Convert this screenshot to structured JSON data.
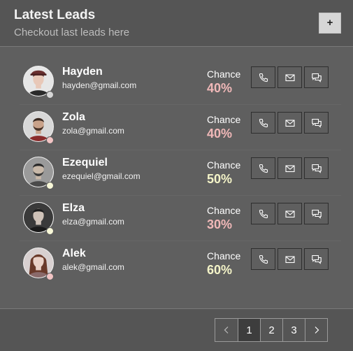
{
  "header": {
    "title": "Latest Leads",
    "subtitle": "Checkout last leads here",
    "add_label": "+"
  },
  "chance_label": "Chance",
  "leads": [
    {
      "name": "Hayden",
      "email": "hayden@gmail.com",
      "chance": "40%",
      "chance_color": "#f0b8b8",
      "status_color": "#d6d6d6"
    },
    {
      "name": "Zola",
      "email": "zola@gmail.com",
      "chance": "40%",
      "chance_color": "#f0b8b8",
      "status_color": "#f2c4c4"
    },
    {
      "name": "Ezequiel",
      "email": "ezequiel@gmail.com",
      "chance": "50%",
      "chance_color": "#f4f4c8",
      "status_color": "#f8f8d8"
    },
    {
      "name": "Elza",
      "email": "elza@gmail.com",
      "chance": "30%",
      "chance_color": "#f0b8b8",
      "status_color": "#f8f8d8"
    },
    {
      "name": "Alek",
      "email": "alek@gmail.com",
      "chance": "60%",
      "chance_color": "#f4f4c8",
      "status_color": "#f2c4c4"
    }
  ],
  "actions": [
    "phone-icon",
    "mail-icon",
    "chat-icon"
  ],
  "pagination": {
    "prev": "chevron-left-icon",
    "pages": [
      "1",
      "2",
      "3"
    ],
    "active": "1",
    "next": "chevron-right-icon"
  }
}
